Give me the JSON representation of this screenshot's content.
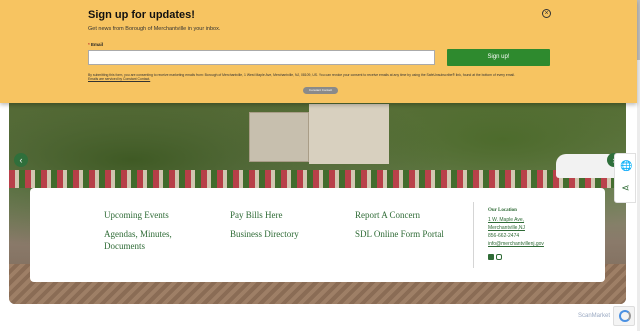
{
  "signup": {
    "title": "Sign up for updates!",
    "subtitle": "Get news from Borough of Merchantville in your inbox.",
    "email_label": "Email",
    "email_required_mark": "*",
    "email_value": "",
    "button_label": "Sign up!",
    "disclaimer": "By submitting this form, you are consenting to receive marketing emails from: Borough of Merchantville, 1 West Maple Ave, Merchantville, NJ, 08109, US. You can revoke your consent to receive emails at any time by using the SafeUnsubscribe® link, found at the bottom of every email.",
    "cc_link": "Emails are serviced by Constant Contact.",
    "badge": "Constant Contact"
  },
  "links": {
    "col1": [
      "Upcoming Events",
      "Agendas, Minutes, Documents"
    ],
    "col2": [
      "Pay Bills Here",
      "Business Directory"
    ],
    "col3": [
      "Report A Concern",
      "SDL Online Form Portal"
    ]
  },
  "contact": {
    "heading": "Our Location",
    "address1": "1 W. Maple Ave,",
    "address2": "Merchantville,NJ",
    "phone": "856-662-2474",
    "email": "info@merchantvillenj.gov"
  },
  "footer": {
    "watermark": "ScanMarket"
  },
  "icons": {
    "close": "close-icon",
    "prev": "chevron-left-icon",
    "next": "chevron-right-icon",
    "globe": "globe-icon",
    "share": "share-icon"
  },
  "colors": {
    "modal_bg": "#f7c461",
    "accent_green": "#2e8a2e",
    "link_green": "#2f6b36"
  }
}
